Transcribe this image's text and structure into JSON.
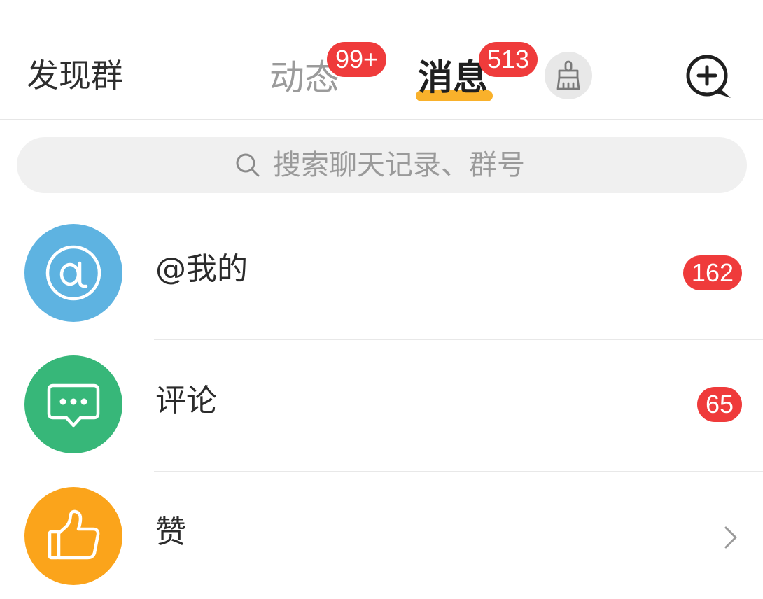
{
  "header": {
    "discover_label": "发现群",
    "tabs": [
      {
        "label": "动态",
        "badge": "99+",
        "active": false
      },
      {
        "label": "消息",
        "badge": "513",
        "active": true
      }
    ],
    "clean_icon": "broom-icon",
    "compose_icon": "chat-plus-icon"
  },
  "search": {
    "placeholder": "搜索聊天记录、群号",
    "icon": "search-icon"
  },
  "list": [
    {
      "label": "@我的",
      "badge": "162",
      "icon": "at-icon",
      "color": "#5eb3e1"
    },
    {
      "label": "评论",
      "badge": "65",
      "icon": "comment-icon",
      "color": "#37b779"
    },
    {
      "label": "赞",
      "icon": "thumbs-up-icon",
      "color": "#fba41b",
      "trailing_icon": "chevron-right-icon"
    }
  ],
  "colors": {
    "badge": "#ef3b3b",
    "active_tab_underline": "#f9b12b",
    "inactive_tab_text": "#9b9b9b"
  }
}
